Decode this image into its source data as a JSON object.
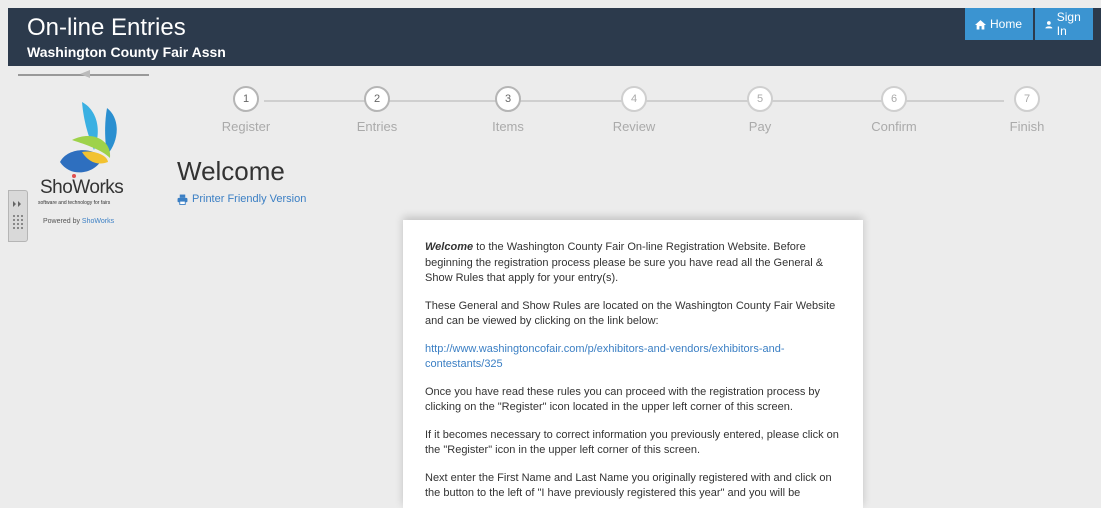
{
  "header": {
    "title": "On-line Entries",
    "subtitle": "Washington County Fair Assn",
    "home_label": "Home",
    "signin_label": "Sign In"
  },
  "sidebar": {
    "logo_text": "ShoWorks",
    "logo_tagline": "software and technology for fairs",
    "powered_prefix": "Powered by",
    "powered_brand": "ShoWorks"
  },
  "steps": [
    {
      "num": "1",
      "label": "Register"
    },
    {
      "num": "2",
      "label": "Entries"
    },
    {
      "num": "3",
      "label": "Items"
    },
    {
      "num": "4",
      "label": "Review"
    },
    {
      "num": "5",
      "label": "Pay"
    },
    {
      "num": "6",
      "label": "Confirm"
    },
    {
      "num": "7",
      "label": "Finish"
    }
  ],
  "main": {
    "heading": "Welcome",
    "printer_link": "Printer Friendly Version",
    "intro_em": "Welcome",
    "intro_rest": " to the Washington County Fair On-line Registration Website.  Before beginning the registration process please be sure you have read all the General & Show Rules that apply for your entry(s).",
    "para2": "These General and Show Rules are located on the Washington County Fair Website and can be viewed by clicking on the link below:",
    "link": "http://www.washingtoncofair.com/p/exhibitors-and-vendors/exhibitors-and-contestants/325",
    "para3": "Once you have read these rules you can proceed with the registration process by clicking on the \"Register\" icon located in the upper left corner of this screen.",
    "para4": "If it becomes necessary to correct information you previously entered, please click on the \"Register\" icon in the upper left corner of this screen.",
    "para5": "Next enter the First Name and Last Name you originally registered with and click on the button to the left of \"I have previously registered this year\" and you will be"
  }
}
